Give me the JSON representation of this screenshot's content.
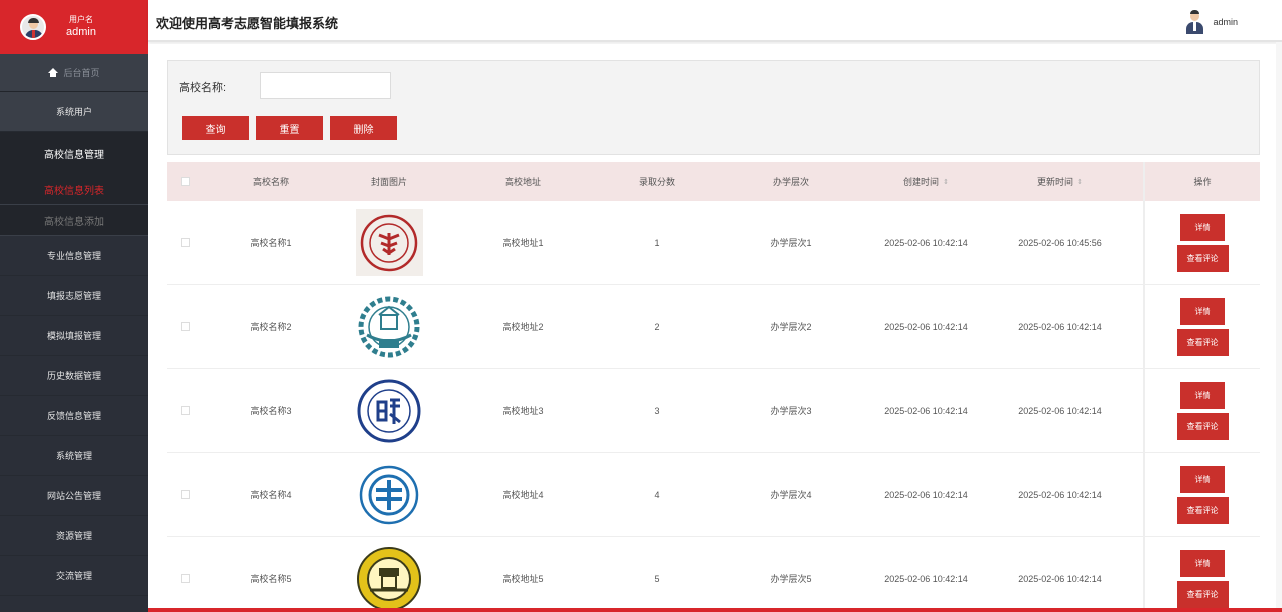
{
  "sidebar": {
    "user_label": "用户名",
    "user_name": "admin",
    "home": "后台首页",
    "items": [
      {
        "label": "系统用户"
      },
      {
        "label": "高校信息管理"
      },
      {
        "label": "专业信息管理"
      },
      {
        "label": "填报志愿管理"
      },
      {
        "label": "模拟填报管理"
      },
      {
        "label": "历史数据管理"
      },
      {
        "label": "反馈信息管理"
      },
      {
        "label": "系统管理"
      },
      {
        "label": "网站公告管理"
      },
      {
        "label": "资源管理"
      },
      {
        "label": "交流管理"
      }
    ],
    "sub_items": [
      {
        "label": "高校信息列表"
      },
      {
        "label": "高校信息添加"
      }
    ]
  },
  "topbar": {
    "title": "欢迎使用高考志愿智能填报系统",
    "user": "admin"
  },
  "search": {
    "label": "高校名称:",
    "value": "",
    "buttons": {
      "query": "查询",
      "reset": "重置",
      "delete": "删除"
    }
  },
  "table": {
    "headers": {
      "name": "高校名称",
      "cover": "封面图片",
      "address": "高校地址",
      "score": "录取分数",
      "level": "办学层次",
      "created": "创建时间",
      "updated": "更新时间",
      "ops": "操作"
    },
    "sort_glyph": "⇕",
    "rows": [
      {
        "name": "高校名称1",
        "address": "高校地址1",
        "score": "1",
        "level": "办学层次1",
        "created": "2025-02-06 10:42:14",
        "updated": "2025-02-06 10:45:56",
        "logo": "peking-logo"
      },
      {
        "name": "高校名称2",
        "address": "高校地址2",
        "score": "2",
        "level": "办学层次2",
        "created": "2025-02-06 10:42:14",
        "updated": "2025-02-06 10:42:14",
        "logo": "hit-logo"
      },
      {
        "name": "高校名称3",
        "address": "高校地址3",
        "score": "3",
        "level": "办学层次3",
        "created": "2025-02-06 10:42:14",
        "updated": "2025-02-06 10:42:14",
        "logo": "fudan-logo"
      },
      {
        "name": "高校名称4",
        "address": "高校地址4",
        "score": "4",
        "level": "办学层次4",
        "created": "2025-02-06 10:42:14",
        "updated": "2025-02-06 10:42:14",
        "logo": "dalian-logo"
      },
      {
        "name": "高校名称5",
        "address": "高校地址5",
        "score": "5",
        "level": "办学层次5",
        "created": "2025-02-06 10:42:14",
        "updated": "2025-02-06 10:42:14",
        "logo": "southeast-logo"
      }
    ],
    "row_buttons": {
      "detail": "详情",
      "comments": "查看评论"
    }
  },
  "colors": {
    "accent": "#d8262b",
    "button": "#c9302c",
    "sidebar": "#2b2f38",
    "table_header": "#f3e4e4"
  }
}
